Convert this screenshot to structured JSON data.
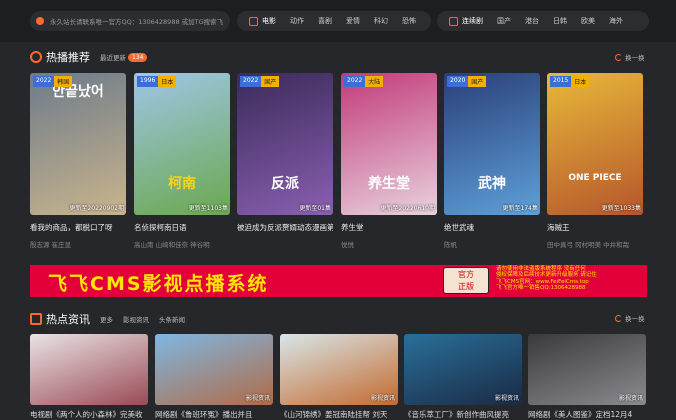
{
  "topbar": {
    "notice": "永久站长请联系唯一官方QQ：1306428988 或加TG搜索飞",
    "movie": {
      "head": "电影",
      "links": [
        "动作",
        "喜剧",
        "爱情",
        "科幻",
        "恐怖"
      ]
    },
    "series": {
      "head": "连续剧",
      "links": [
        "国产",
        "港台",
        "日韩",
        "欧美",
        "海外"
      ]
    }
  },
  "hot": {
    "title": "热播推荐",
    "recent_label": "最近更新",
    "recent_count": "134",
    "refresh": "换一换",
    "cards": [
      {
        "year": "2022",
        "region": "韩国",
        "poster_text": "안끝났어",
        "update": "更新至20220902期",
        "title": "看我的商品，都脱口了呀",
        "actors": "殷志源 崔庄显",
        "color1": "#6d7b8a",
        "color2": "#c9b48d"
      },
      {
        "year": "1996",
        "region": "日本",
        "poster_text": "柯南",
        "update": "更新至1103集",
        "title": "名侦探柯南日语",
        "actors": "高山南 山崎和佳奈 神谷明",
        "color1": "#9fc6e6",
        "color2": "#6aa84f"
      },
      {
        "year": "2022",
        "region": "国产",
        "poster_text": "反派",
        "update": "更新至01集",
        "title": "被迫成为反派赘婿动态漫画第三季",
        "actors": "",
        "color1": "#3a2b5a",
        "color2": "#8a5fb0"
      },
      {
        "year": "2022",
        "region": "大陆",
        "poster_text": "养生堂",
        "update": "更新至20220610期",
        "title": "养生堂",
        "actors": "悦悦",
        "color1": "#c23a7a",
        "color2": "#e8d2dd"
      },
      {
        "year": "2020",
        "region": "国产",
        "poster_text": "武神",
        "update": "更新至174集",
        "title": "绝世武魂",
        "actors": "陈帆",
        "color1": "#2a3f7a",
        "color2": "#5ea0d8"
      },
      {
        "year": "2015",
        "region": "日本",
        "poster_text": "ONE PIECE",
        "update": "更新至1033集",
        "title": "海贼王",
        "actors": "田中真弓 冈村明美 中井和哉",
        "color1": "#e7b93a",
        "color2": "#b5562b"
      }
    ]
  },
  "banner": {
    "headline": "飞飞CMS影视点播系统",
    "seal_top": "官方",
    "seal_bottom": "正版",
    "info": [
      "请勿使用非法盗版系统程序 没有任何",
      "侵权保障及后续技术更新升级服务 请记住",
      "飞飞CMS官网：www.FeiFeiCms.top",
      "飞飞官方唯一销售QQ:1306428988"
    ]
  },
  "news": {
    "title": "热点资讯",
    "more": "更多",
    "links": [
      "影视资讯",
      "头条新闻"
    ],
    "refresh": "换一换",
    "items": [
      {
        "label": "",
        "title": "电视剧《两个人的小森林》完美收",
        "color1": "#e9e3e5",
        "color2": "#9a4a55"
      },
      {
        "label": "影视资讯",
        "title": "网络剧《鲁班环冤》播出并且",
        "color1": "#7fb7e2",
        "color2": "#b06b46"
      },
      {
        "label": "影视资讯",
        "title": "《山河锦绣》姜冠南陆挂帮 刘天",
        "color1": "#d8e6ea",
        "color2": "#c46a2e"
      },
      {
        "label": "影视资讯",
        "title": "《音乐萃工厂》新创作曲风提亮",
        "color1": "#2a6f9a",
        "color2": "#1a2a44"
      },
      {
        "label": "影视资讯",
        "title": "网络剧《美人图鉴》定档12月4",
        "color1": "#3a3a3e",
        "color2": "#8a8a90"
      }
    ]
  }
}
